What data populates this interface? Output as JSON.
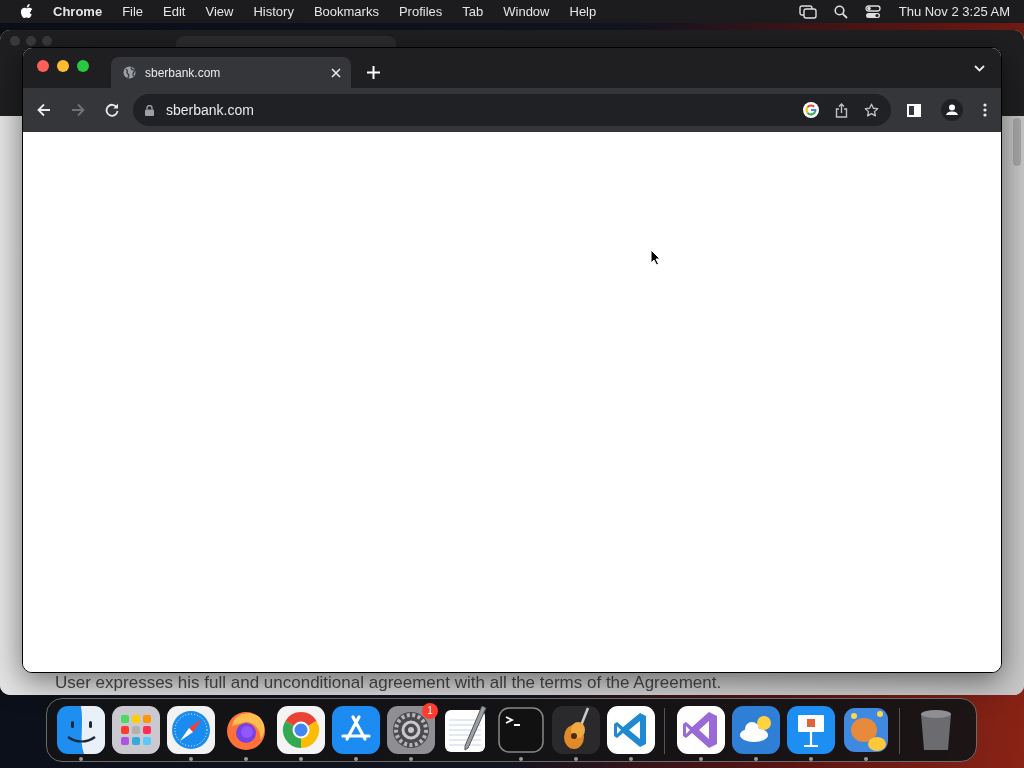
{
  "menu_bar": {
    "app": "Chrome",
    "menus": [
      "File",
      "Edit",
      "View",
      "History",
      "Bookmarks",
      "Profiles",
      "Tab",
      "Window",
      "Help"
    ],
    "clock": "Thu Nov 2  3:25 AM"
  },
  "background_window": {
    "footer_text": "User expresses his full and unconditional agreement with all the terms of the Agreement."
  },
  "browser": {
    "tabs": [
      {
        "title": "sberbank.com",
        "selected": true
      }
    ],
    "back_disabled": false,
    "forward_disabled": true,
    "address": "sberbank.com"
  },
  "dock": {
    "groups": [
      [
        {
          "kind": "finder",
          "running": true
        },
        {
          "kind": "launchpad",
          "running": false
        },
        {
          "kind": "safari",
          "running": true
        },
        {
          "kind": "firefox",
          "running": true
        },
        {
          "kind": "chrome",
          "running": true
        },
        {
          "kind": "appstore",
          "running": true
        },
        {
          "kind": "settings",
          "running": true,
          "badge": "1"
        },
        {
          "kind": "textedit",
          "running": false
        },
        {
          "kind": "terminal",
          "running": true
        },
        {
          "kind": "garageband",
          "running": true
        },
        {
          "kind": "vscode",
          "running": true
        }
      ],
      [
        {
          "kind": "visualstudio",
          "running": true
        },
        {
          "kind": "weather",
          "running": true
        },
        {
          "kind": "keynote",
          "running": true
        },
        {
          "kind": "game",
          "running": true
        }
      ],
      [
        {
          "kind": "trash",
          "running": false
        }
      ]
    ]
  }
}
